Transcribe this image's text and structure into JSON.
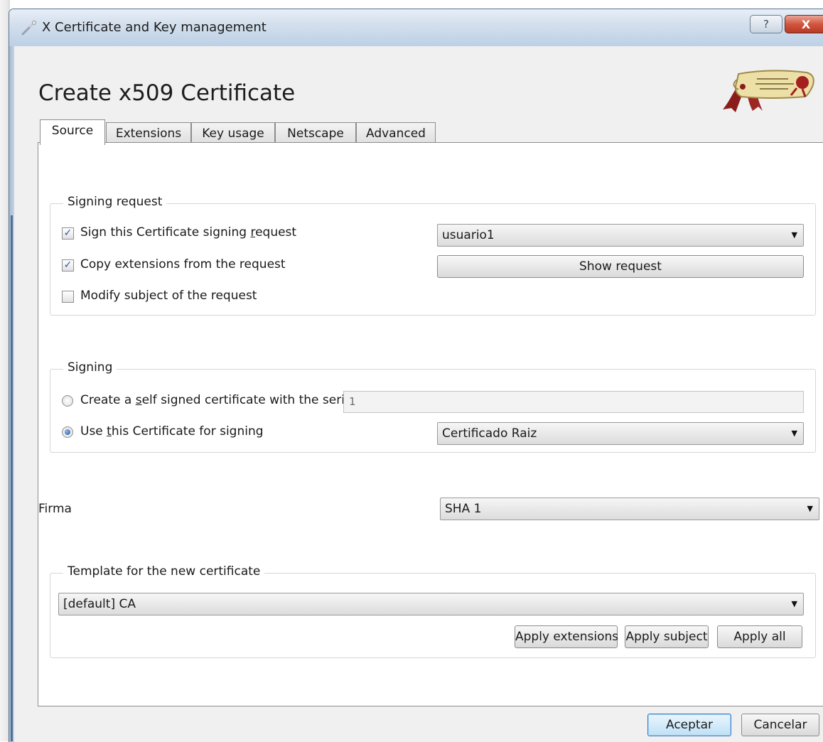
{
  "window": {
    "title": "X Certificate and Key management",
    "help_label": "?",
    "close_label": "X"
  },
  "dialog": {
    "heading": "Create x509 Certificate"
  },
  "tabs": [
    {
      "label": "Source",
      "active": true
    },
    {
      "label": "Extensions",
      "active": false
    },
    {
      "label": "Key usage",
      "active": false
    },
    {
      "label": "Netscape",
      "active": false
    },
    {
      "label": "Advanced",
      "active": false
    }
  ],
  "signing_request": {
    "title": "Signing request",
    "sign_csr": {
      "label_pre": "Sign this Certificate signing ",
      "label_u": "r",
      "label_post": "equest",
      "checked": true
    },
    "copy_ext": {
      "label": "Copy extensions from the request",
      "checked": true
    },
    "modify_subject": {
      "label": "Modify subject of the request",
      "checked": false
    },
    "request_select": "usuario1",
    "show_request_label": "Show request"
  },
  "signing": {
    "title": "Signing",
    "self_signed": {
      "label_pre": "Create a ",
      "label_u": "s",
      "label_post": "elf signed certificate with the serial",
      "selected": false
    },
    "serial_value": "1",
    "use_cert": {
      "label_pre": "Use ",
      "label_u": "t",
      "label_post": "his Certificate for signing",
      "selected": true
    },
    "cert_select": "Certificado Raiz"
  },
  "firma": {
    "label": "Firma",
    "value": "SHA 1"
  },
  "template": {
    "title": "Template for the new certificate",
    "value": "[default] CA",
    "apply_extensions": "Apply extensions",
    "apply_subject": "Apply subject",
    "apply_all": "Apply all"
  },
  "footer": {
    "ok_label": "Aceptar",
    "cancel_label": "Cancelar"
  },
  "colors": {
    "titlebar": "#bcd0e6",
    "close_button": "#c9452f",
    "check_accent": "#2a55a4",
    "default_button_border": "#3d7bc2"
  },
  "icons": {
    "app": "certificate-key-icon",
    "logo": "certificate-seal-logo",
    "combo_arrow": "chevron-down-icon"
  }
}
